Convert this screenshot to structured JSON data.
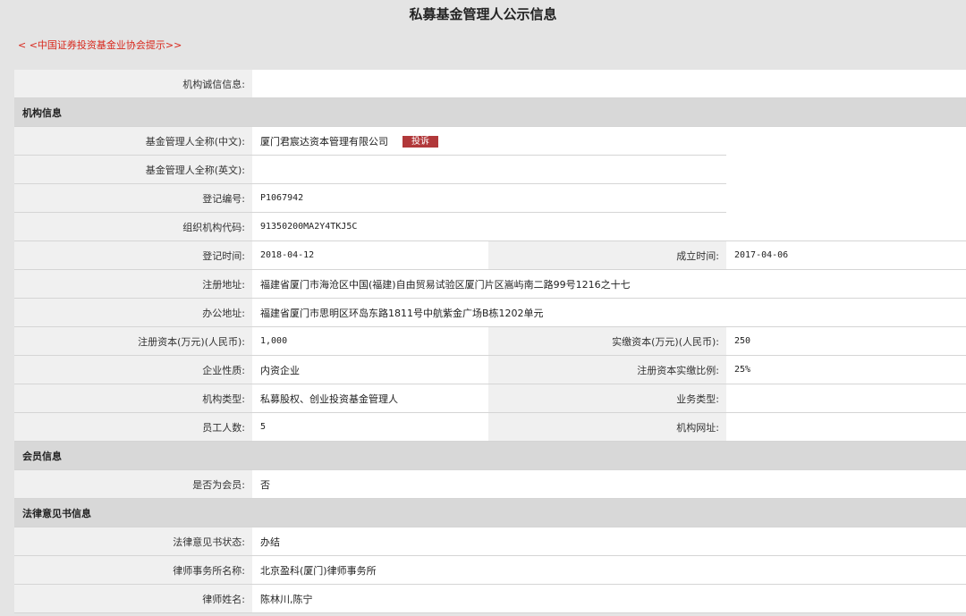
{
  "page": {
    "title": "私募基金管理人公示信息",
    "back_link": "< <中国证券投资基金业协会提示>>"
  },
  "integrity": {
    "label": "机构诚信信息:",
    "value": ""
  },
  "sections": {
    "org": "机构信息",
    "member": "会员信息",
    "legal": "法律意见书信息"
  },
  "org": {
    "name_cn_label": "基金管理人全称(中文):",
    "name_cn": "厦门君宸达资本管理有限公司",
    "complain_label": "投诉",
    "name_en_label": "基金管理人全称(英文):",
    "name_en": "",
    "reg_no_label": "登记编号:",
    "reg_no": "P1067942",
    "org_code_label": "组织机构代码:",
    "org_code": "91350200MA2Y4TKJ5C",
    "reg_date_label": "登记时间:",
    "reg_date": "2018-04-12",
    "found_date_label": "成立时间:",
    "found_date": "2017-04-06",
    "reg_addr_label": "注册地址:",
    "reg_addr": "福建省厦门市海沧区中国(福建)自由贸易试验区厦门片区嵩屿南二路99号1216之十七",
    "office_addr_label": "办公地址:",
    "office_addr": "福建省厦门市思明区环岛东路1811号中航紫金广场B栋1202单元",
    "reg_capital_label": "注册资本(万元)(人民币):",
    "reg_capital": "1,000",
    "paid_capital_label": "实缴资本(万元)(人民币):",
    "paid_capital": "250",
    "nature_label": "企业性质:",
    "nature": "内资企业",
    "paid_ratio_label": "注册资本实缴比例:",
    "paid_ratio": "25%",
    "type_label": "机构类型:",
    "type": "私募股权、创业投资基金管理人",
    "biz_type_label": "业务类型:",
    "biz_type": "",
    "staff_label": "员工人数:",
    "staff": "5",
    "website_label": "机构网址:",
    "website": ""
  },
  "member": {
    "is_member_label": "是否为会员:",
    "is_member": "否"
  },
  "legal": {
    "status_label": "法律意见书状态:",
    "status": "办结",
    "firm_label": "律师事务所名称:",
    "firm": "北京盈科(厦门)律师事务所",
    "lawyer_label": "律师姓名:",
    "lawyer": "陈林川,陈宁"
  }
}
